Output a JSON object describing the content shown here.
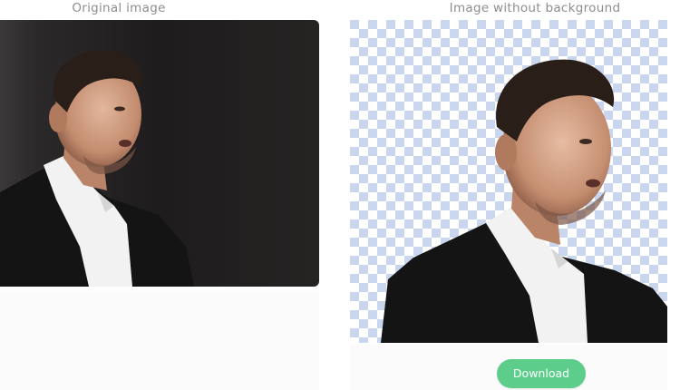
{
  "labels": {
    "original_heading": "Original image",
    "result_heading": "Image without background",
    "download_button": "Download"
  },
  "colors": {
    "download_button": "#5ccd8b",
    "checker_blue": "#c9d6ee",
    "checker_white": "#ffffff",
    "photo_background": "#1f1d1d"
  },
  "icons": {
    "checkerboard": "transparency-checkerboard"
  }
}
